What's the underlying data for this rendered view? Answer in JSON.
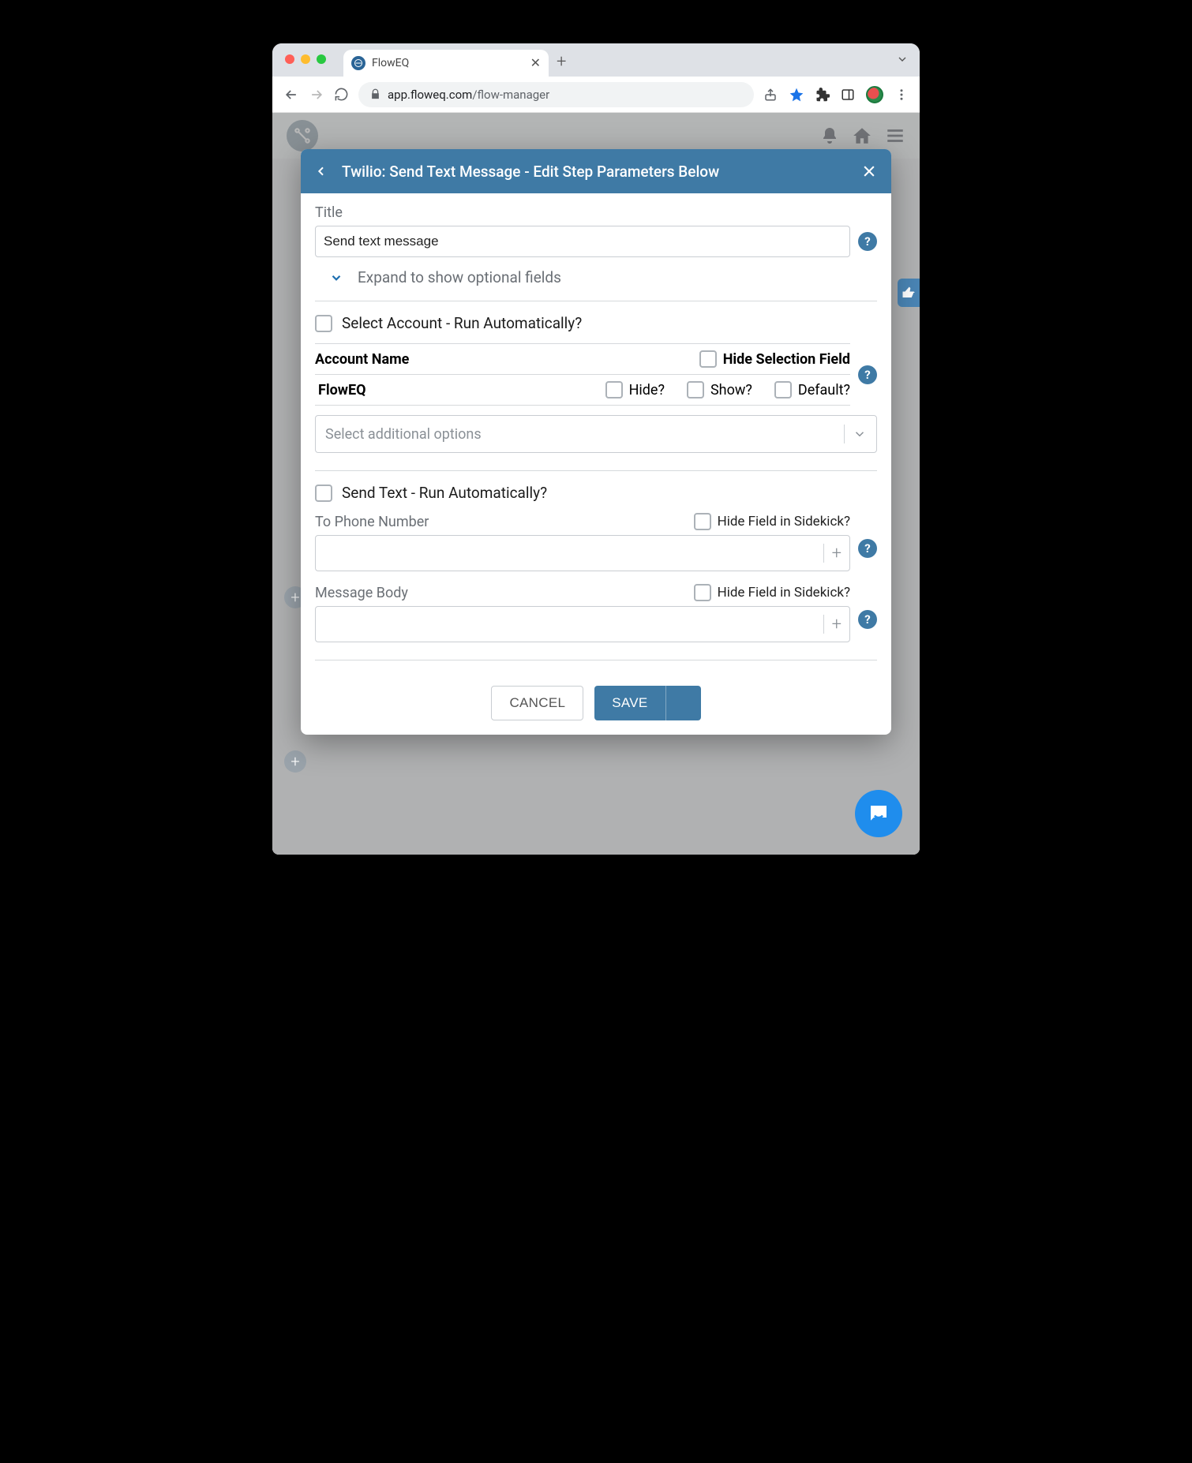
{
  "browser": {
    "tab_title": "FlowEQ",
    "url_host": "app.floweq.com",
    "url_path": "/flow-manager"
  },
  "modal": {
    "header_title": "Twilio: Send Text Message - Edit Step Parameters Below",
    "title_label": "Title",
    "title_value": "Send text message",
    "expand_label": "Expand to show optional fields",
    "section1": {
      "run_auto_label": "Select Account - Run Automatically?",
      "account_name_header": "Account Name",
      "hide_selection_label": "Hide Selection Field",
      "account_row_name": "FlowEQ",
      "hide_label": "Hide?",
      "show_label": "Show?",
      "default_label": "Default?",
      "select_placeholder": "Select additional options"
    },
    "section2": {
      "run_auto_label": "Send Text - Run Automatically?",
      "phone_label": "To Phone Number",
      "phone_hide_label": "Hide Field in Sidekick?",
      "body_label": "Message Body",
      "body_hide_label": "Hide Field in Sidekick?"
    },
    "footer": {
      "cancel": "CANCEL",
      "save": "SAVE"
    }
  }
}
